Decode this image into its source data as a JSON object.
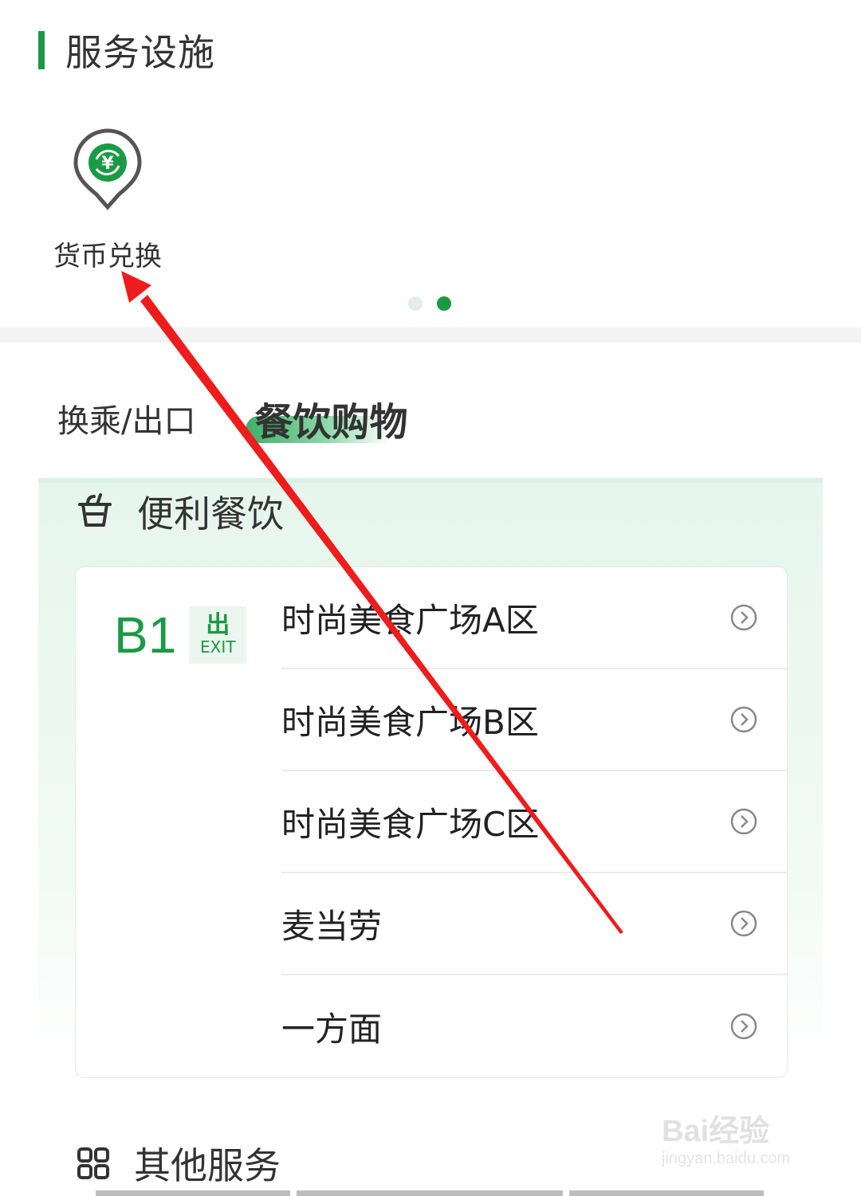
{
  "section": {
    "title": "服务设施"
  },
  "facilities": [
    {
      "label": "货币兑换",
      "icon": "currency-exchange-icon"
    }
  ],
  "pager": {
    "total": 2,
    "active_index": 1
  },
  "tabs": [
    {
      "label": "换乘/出口",
      "active": false
    },
    {
      "label": "餐饮购物",
      "active": true
    }
  ],
  "category": {
    "title": "便利餐饮",
    "icon": "drink-cup-icon"
  },
  "floor": {
    "label": "B1",
    "exit_cn": "出",
    "exit_en": "EXIT"
  },
  "list": [
    {
      "label": "时尚美食广场A区"
    },
    {
      "label": "时尚美食广场B区"
    },
    {
      "label": "时尚美食广场C区"
    },
    {
      "label": "麦当劳"
    },
    {
      "label": "一方面"
    }
  ],
  "other": {
    "title": "其他服务",
    "icon": "grid-icon"
  },
  "watermark": {
    "main": "Bai经验",
    "sub": "jingyan.baidu.com"
  },
  "colors": {
    "accent": "#1a9a45",
    "annotation": "#ee1c1c"
  }
}
